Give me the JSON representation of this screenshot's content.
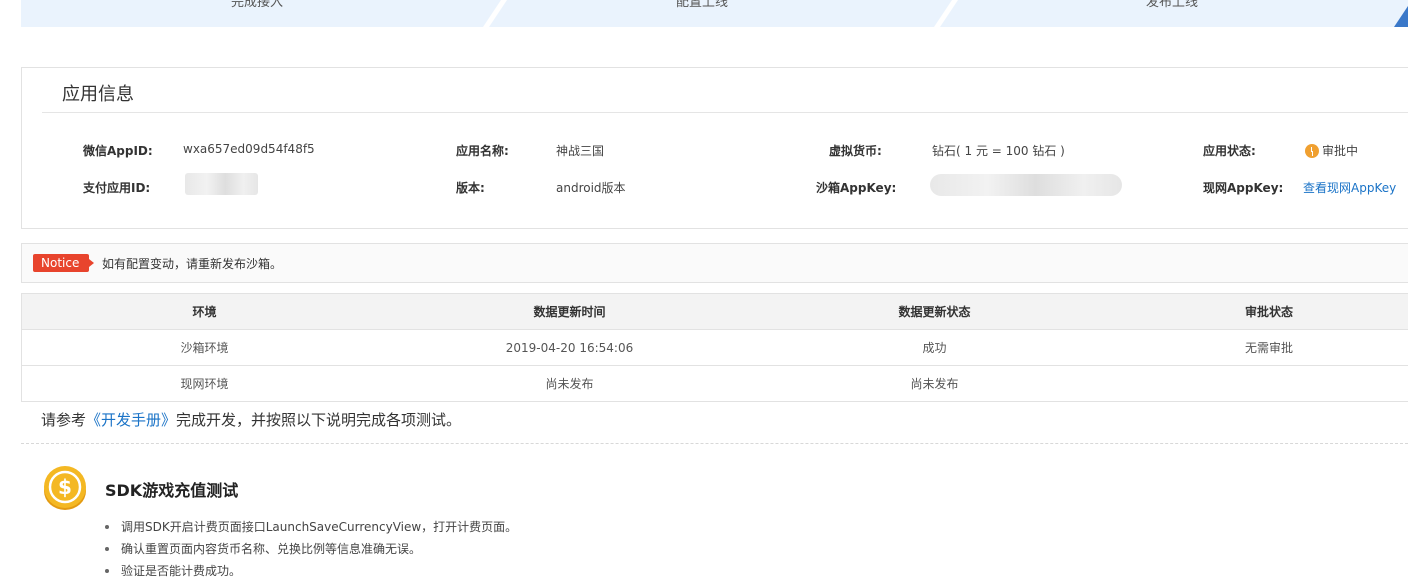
{
  "steps": [
    "完成接入",
    "配置上线",
    "发布上线"
  ],
  "app_info": {
    "title": "应用信息",
    "fields": {
      "wechat_appid": {
        "label": "微信AppID:",
        "value": "wxa657ed09d54f48f5"
      },
      "pay_appid": {
        "label": "支付应用ID:",
        "value": ""
      },
      "app_name": {
        "label": "应用名称:",
        "value": "神战三国"
      },
      "version": {
        "label": "版本:",
        "value": "android版本"
      },
      "currency": {
        "label": "虚拟货币:",
        "value": "钻石( 1 元 = 100 钻石 )"
      },
      "sandbox_key": {
        "label": "沙箱AppKey:",
        "value": ""
      },
      "app_status": {
        "label": "应用状态:",
        "value": "审批中"
      },
      "live_key": {
        "label": "现网AppKey:",
        "value": "查看现网AppKey"
      }
    }
  },
  "notice": {
    "tag": "Notice",
    "text": "如有配置变动，请重新发布沙箱。"
  },
  "env_table": {
    "headers": [
      "环境",
      "数据更新时间",
      "数据更新状态",
      "审批状态"
    ],
    "rows": [
      [
        "沙箱环境",
        "2019-04-20 16:54:06",
        "成功",
        "无需审批"
      ],
      [
        "现网环境",
        "尚未发布",
        "尚未发布",
        ""
      ]
    ]
  },
  "guide": {
    "prefix": "请参考",
    "link": "《开发手册》",
    "suffix": "完成开发，并按照以下说明完成各项测试。"
  },
  "sdk_test": {
    "icon": "coin-dollar-icon",
    "title": "SDK游戏充值测试",
    "bullets": [
      "调用SDK开启计费页面接口LaunchSaveCurrencyView，打开计费页面。",
      "确认重置页面内容货币名称、兑换比例等信息准确无误。",
      "验证是否能计费成功。"
    ]
  },
  "colors": {
    "accent": "#1a73c7",
    "notice": "#e8442d",
    "pending": "#f0a030",
    "coin": "#f4b823"
  }
}
